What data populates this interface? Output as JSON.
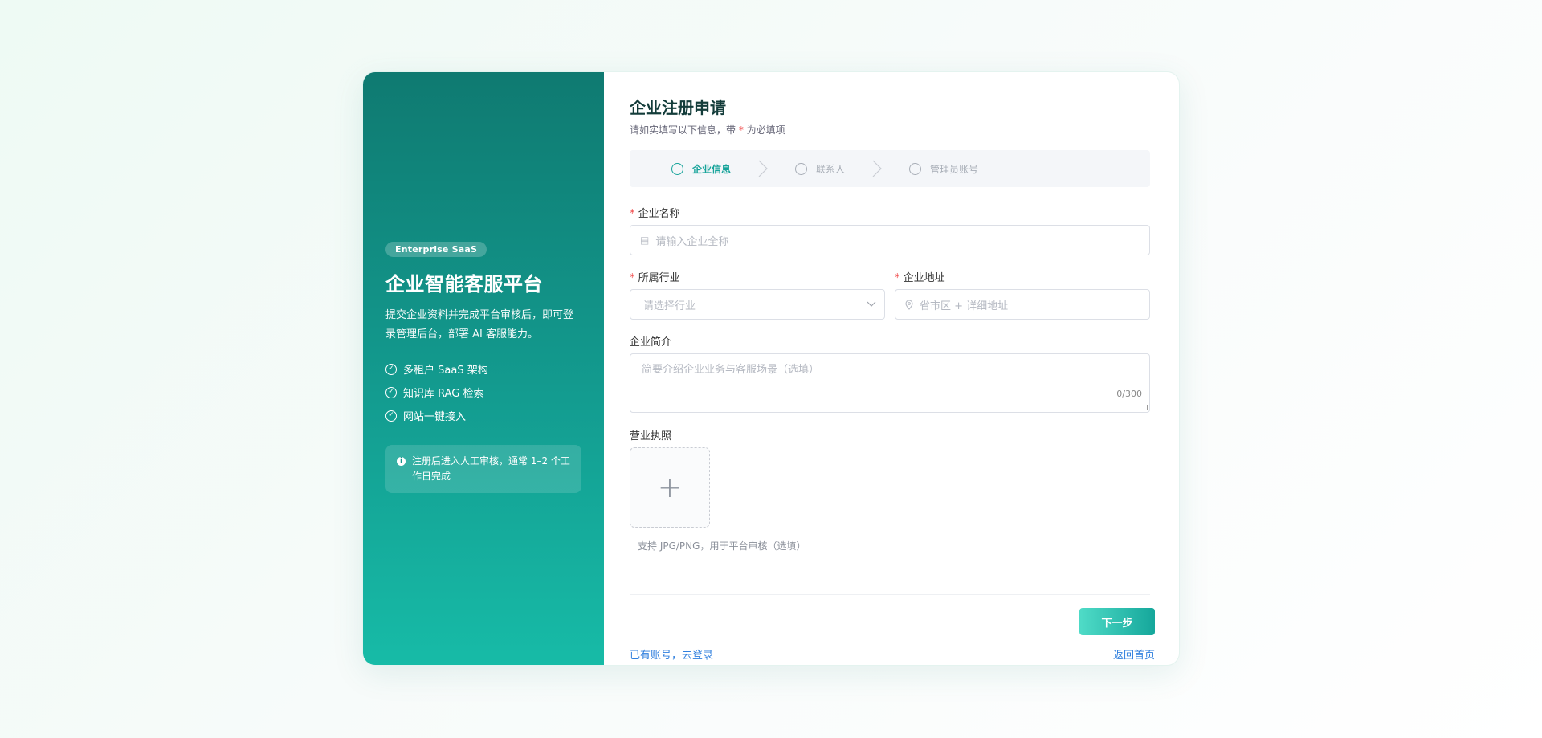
{
  "brand": {
    "badge": "Enterprise SaaS",
    "title": "企业智能客服平台",
    "description": "提交企业资料并完成平台审核后，即可登录管理后台，部署 AI 客服能力。",
    "features": [
      "多租户 SaaS 架构",
      "知识库 RAG 检索",
      "网站一键接入"
    ],
    "notice": "注册后进入人工审核，通常 1–2 个工作日完成"
  },
  "form": {
    "title": "企业注册申请",
    "subtitle_prefix": "请如实填写以下信息，带 ",
    "subtitle_star": "*",
    "subtitle_suffix": " 为必填项",
    "steps": [
      {
        "label": "企业信息",
        "active": true
      },
      {
        "label": "联系人",
        "active": false
      },
      {
        "label": "管理员账号",
        "active": false
      }
    ],
    "company_name": {
      "label": "企业名称",
      "placeholder": "请输入企业全称"
    },
    "industry": {
      "label": "所属行业",
      "placeholder": "请选择行业"
    },
    "address": {
      "label": "企业地址",
      "placeholder": "省市区 + 详细地址"
    },
    "intro": {
      "label": "企业简介",
      "placeholder": "简要介绍企业业务与客服场景（选填）",
      "counter": "0/300"
    },
    "license": {
      "label": "营业执照",
      "hint": "支持 JPG/PNG，用于平台审核（选填）"
    },
    "next_label": "下一步",
    "login_link": "已有账号，去登录",
    "home_link": "返回首页",
    "accent_color": "#16a39a"
  }
}
